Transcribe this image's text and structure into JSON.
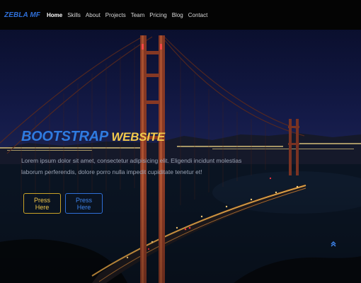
{
  "navbar": {
    "brand": "ZEBLA MF",
    "links": [
      {
        "label": "Home",
        "active": true
      },
      {
        "label": "Skills"
      },
      {
        "label": "About"
      },
      {
        "label": "Projects"
      },
      {
        "label": "Team"
      },
      {
        "label": "Pricing"
      },
      {
        "label": "Blog"
      },
      {
        "label": "Contact"
      }
    ]
  },
  "hero": {
    "title_part1": "BOOTSTRAP",
    "title_part2": "WEBSITE",
    "description": "Lorem ipsum dolor sit amet, consectetur adipisicing elit. Eligendi incidunt molestias laborum perferendis, dolore porro nulla impedit cupiditate tenetur et!",
    "button_primary": "Press Here",
    "button_secondary": "Press Here",
    "background_image": "golden-gate-bridge-night"
  },
  "scroll_top": {
    "icon": "double-chevron-up-icon",
    "glyph": "⌃"
  },
  "colors": {
    "brand": "#2f6fd8",
    "accent_yellow": "#f2c94c",
    "nav_bg": "#040404"
  }
}
